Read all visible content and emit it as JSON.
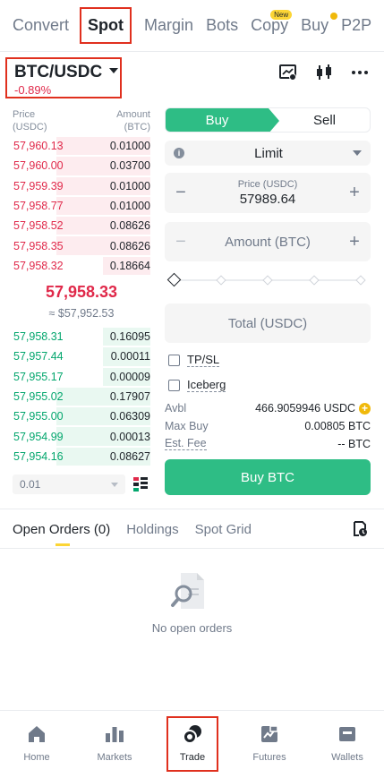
{
  "top_tabs": [
    {
      "label": "Convert"
    },
    {
      "label": "Spot",
      "active": true
    },
    {
      "label": "Margin"
    },
    {
      "label": "Bots"
    },
    {
      "label": "Copy",
      "badge": "New"
    },
    {
      "label": "Buy"
    },
    {
      "label": "P2P"
    }
  ],
  "pair": {
    "symbol": "BTC/USDC",
    "change": "-0.89%"
  },
  "header_icons": [
    "chart-settings-icon",
    "candlestick-icon",
    "more-icon"
  ],
  "orderbook": {
    "price_header": "Price",
    "price_unit": "(USDC)",
    "amount_header": "Amount",
    "amount_unit": "(BTC)",
    "asks": [
      {
        "price": "57,960.13",
        "amount": "0.01000",
        "depth": 0.62
      },
      {
        "price": "57,960.00",
        "amount": "0.03700",
        "depth": 0.62
      },
      {
        "price": "57,959.39",
        "amount": "0.01000",
        "depth": 0.62
      },
      {
        "price": "57,958.77",
        "amount": "0.01000",
        "depth": 0.62
      },
      {
        "price": "57,958.52",
        "amount": "0.08626",
        "depth": 0.62
      },
      {
        "price": "57,958.35",
        "amount": "0.08626",
        "depth": 0.62
      },
      {
        "price": "57,958.32",
        "amount": "0.18664",
        "depth": 0.31
      }
    ],
    "mid_price": "57,958.33",
    "mid_fiat": "≈ $57,952.53",
    "bids": [
      {
        "price": "57,958.31",
        "amount": "0.16095",
        "depth": 0.31
      },
      {
        "price": "57,957.44",
        "amount": "0.00011",
        "depth": 0.31
      },
      {
        "price": "57,955.17",
        "amount": "0.00009",
        "depth": 0.31
      },
      {
        "price": "57,955.02",
        "amount": "0.17907",
        "depth": 0.62
      },
      {
        "price": "57,955.00",
        "amount": "0.06309",
        "depth": 0.62
      },
      {
        "price": "57,954.99",
        "amount": "0.00013",
        "depth": 0.62
      },
      {
        "price": "57,954.16",
        "amount": "0.08627",
        "depth": 0.62
      }
    ],
    "precision": "0.01"
  },
  "form": {
    "buy_label": "Buy",
    "sell_label": "Sell",
    "order_type": "Limit",
    "price_label": "Price (USDC)",
    "price_value": "57989.64",
    "amount_placeholder": "Amount (BTC)",
    "total_placeholder": "Total (USDC)",
    "tpsl_label": "TP/SL",
    "iceberg_label": "Iceberg",
    "avbl_label": "Avbl",
    "avbl_value": "466.9059946 USDC",
    "maxbuy_label": "Max Buy",
    "maxbuy_value": "0.00805 BTC",
    "fee_label": "Est. Fee",
    "fee_value": "-- BTC",
    "submit_label": "Buy BTC"
  },
  "orders_tabs": [
    {
      "label": "Open Orders (0)",
      "active": true
    },
    {
      "label": "Holdings"
    },
    {
      "label": "Spot Grid"
    }
  ],
  "empty_text": "No open orders",
  "bottom_nav": [
    {
      "label": "Home",
      "icon": "home-icon"
    },
    {
      "label": "Markets",
      "icon": "bar-chart-icon"
    },
    {
      "label": "Trade",
      "icon": "trade-icon",
      "active": true
    },
    {
      "label": "Futures",
      "icon": "futures-icon"
    },
    {
      "label": "Wallets",
      "icon": "wallet-icon"
    }
  ],
  "colors": {
    "buy": "#2ebd85",
    "sell": "#e0294a",
    "accent": "#fcd535",
    "highlight_box": "#e0301e"
  }
}
